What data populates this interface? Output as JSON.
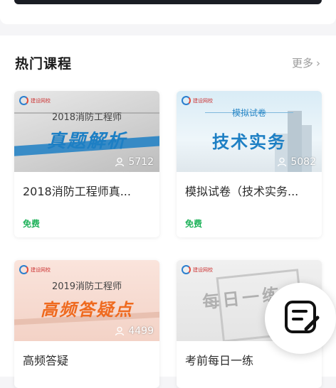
{
  "section": {
    "title": "热门课程",
    "more_label": "更多"
  },
  "courses": [
    {
      "title": "2018消防工程师真...",
      "price": "免费",
      "views": "5712",
      "thumb_sub": "2018消防工程师",
      "thumb_main": "真题解析"
    },
    {
      "title": "模拟试卷（技术实务...",
      "price": "免费",
      "views": "5082",
      "thumb_sub": "模拟试卷",
      "thumb_main": "技术实务"
    },
    {
      "title": "高频答疑",
      "price": "",
      "views": "4499",
      "thumb_sub": "2019消防工程师",
      "thumb_main": "高频答疑点"
    },
    {
      "title": "考前每日一练",
      "price": "",
      "views": "",
      "thumb_sub": "",
      "thumb_main": "每日一练"
    }
  ],
  "colors": {
    "accent_green": "#1fb25a",
    "thumb_blue": "#1d7fc4",
    "thumb_orange": "#ef6a1f"
  },
  "fab": {
    "icon": "edit-note-icon"
  }
}
